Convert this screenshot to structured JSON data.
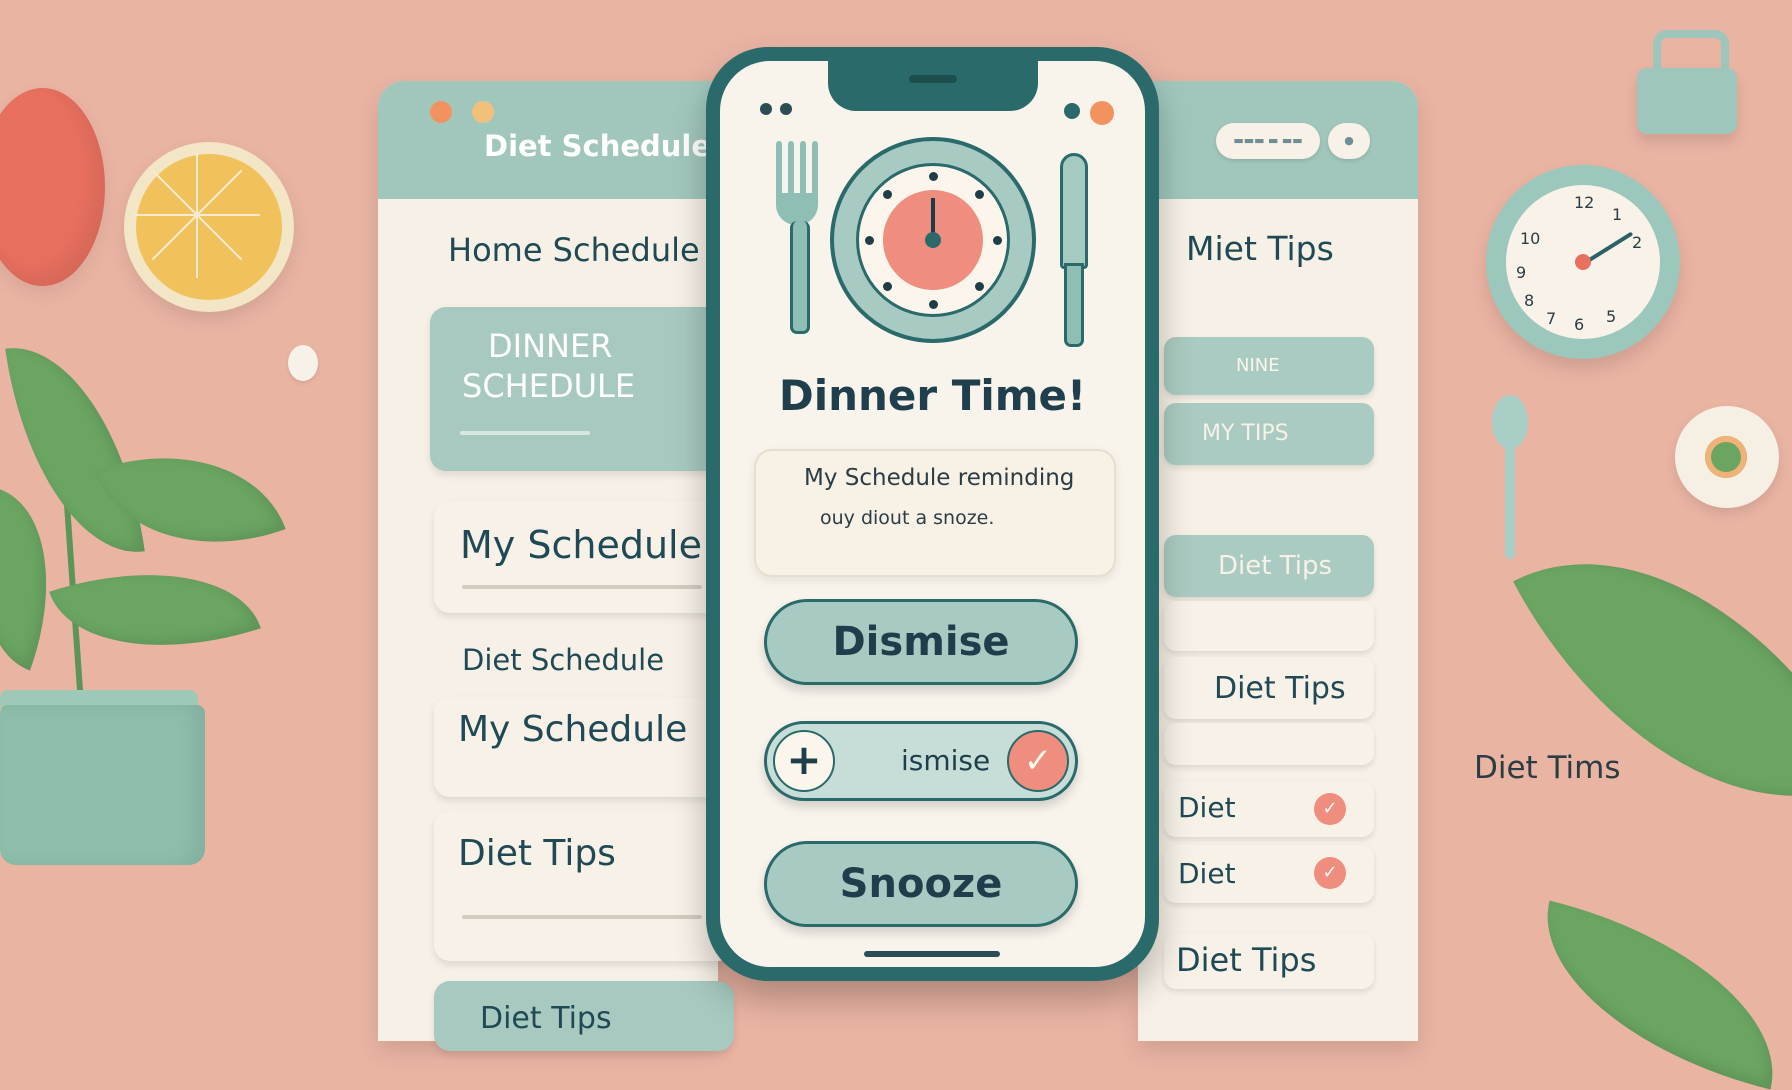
{
  "colors": {
    "background": "#eab4a3",
    "panel": "#f6f0e6",
    "header_teal": "#a1c7bc",
    "accent_coral": "#ef8d7e",
    "dark_teal": "#2a6a6a",
    "leaf_green": "#6aa562"
  },
  "left_app": {
    "title": "Diet Schedule",
    "nav": {
      "home_schedule": "Home Schedule",
      "dinner_schedule_line1": "DINNER",
      "dinner_schedule_line2": "SCHEDULE",
      "my_schedule_1": "My Schedule",
      "diet_schedule": "Diet Schedule",
      "my_schedule_2": "My Schedule",
      "diet_tips": "Diet Tips",
      "diet_tips_bottom": "Diet Tips"
    }
  },
  "right_app": {
    "header_pill_text": "▬▬▬ ▬ ▬▬",
    "header_icon": "toggle-icon",
    "items": {
      "miet_tips": "Miet Tips",
      "nine": "NINE",
      "my_tips": "MY TIPS",
      "diet_tips_1": "Diet Tips",
      "diet_tips_2": "Diet Tips",
      "diet_1": "Diet",
      "diet_2": "Diet",
      "diet_tips_3": "Diet Tips"
    }
  },
  "wall_clock": {
    "numbers": [
      "12",
      "1",
      "2",
      "10",
      "8",
      "7",
      "6",
      "5",
      "9"
    ]
  },
  "side_label": "Diet Tims",
  "phone": {
    "title": "Dinner Time!",
    "message_line1": "My Schedule reminding",
    "message_line2": "ouy diout a snoze.",
    "dismiss_label": "Dismise",
    "toggle_label": "ismise",
    "toggle_plus": "+",
    "toggle_check": "✓",
    "snooze_label": "Snooze"
  }
}
